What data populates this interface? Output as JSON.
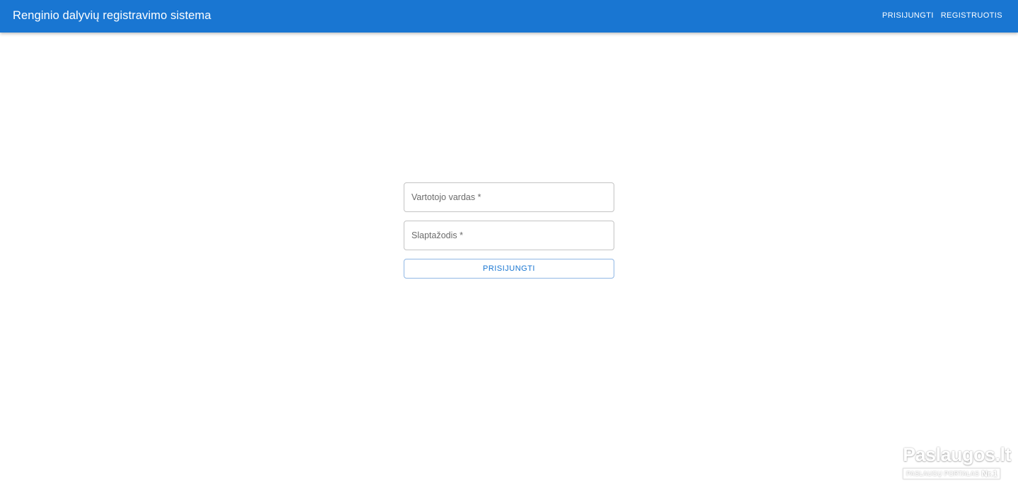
{
  "header": {
    "title": "Renginio dalyvių registravimo sistema",
    "nav": {
      "login": "PRISIJUNGTI",
      "register": "REGISTRUOTIS"
    },
    "color": "#1976d2"
  },
  "login_form": {
    "username": {
      "label": "Vartotojo vardas *",
      "value": ""
    },
    "password": {
      "label": "Slaptažodis *",
      "value": ""
    },
    "submit_label": "PRISIJUNGTI"
  },
  "watermark": {
    "brand": "Paslaugos.lt",
    "subtitle": "PASLAUGŲ PORTALAS",
    "badge": "Nr.1"
  }
}
